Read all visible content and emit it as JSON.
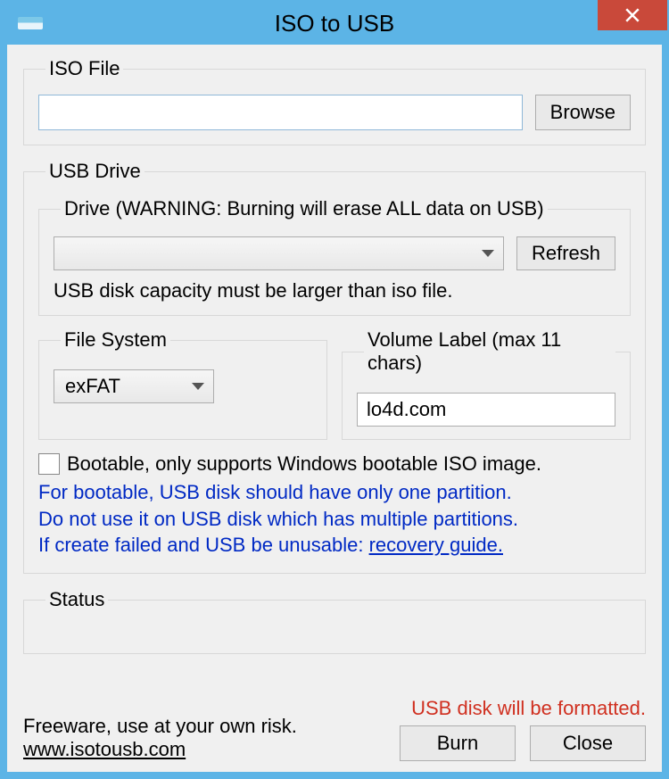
{
  "window": {
    "title": "ISO to USB"
  },
  "iso": {
    "legend": "ISO File",
    "path": "",
    "browse": "Browse"
  },
  "usb": {
    "legend": "USB Drive",
    "drive": {
      "legend": "Drive (WARNING: Burning will erase ALL data on USB)",
      "selected": "",
      "refresh": "Refresh",
      "note": "USB disk capacity must be larger than iso file."
    },
    "fs": {
      "legend": "File System",
      "value": "exFAT"
    },
    "volume": {
      "legend": "Volume Label (max 11 chars)",
      "value": "lo4d.com"
    },
    "bootable": {
      "label": "Bootable, only supports Windows bootable ISO image.",
      "info1": "For bootable, USB disk should have only one partition.",
      "info2": "Do not use it on USB disk which has multiple partitions.",
      "info3_prefix": "If create failed and USB be unusable: ",
      "info3_link": "recovery guide."
    }
  },
  "status": {
    "legend": "Status",
    "text": ""
  },
  "footer": {
    "freeware": "Freeware, use at your own risk.",
    "url": "www.isotousb.com",
    "warning": "USB disk will be formatted.",
    "burn": "Burn",
    "close": "Close"
  }
}
